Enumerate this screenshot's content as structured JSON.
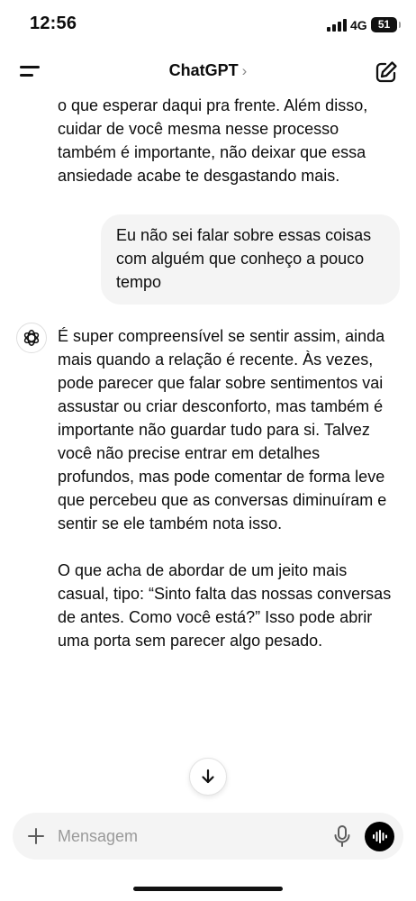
{
  "status_bar": {
    "time": "12:56",
    "network": "4G",
    "battery": "51"
  },
  "header": {
    "title": "ChatGPT",
    "chevron": "›",
    "menu_icon": "hamburger-menu-icon",
    "compose_icon": "new-chat-edit-icon"
  },
  "conversation": {
    "previous_assistant_tail": "o que esperar daqui pra frente. Além disso, cuidar de você mesma nesse processo também é importante, não deixar que essa ansiedade acabe te desgastando mais.",
    "user_message": "Eu não sei falar sobre essas coisas com alguém que conheço a pouco tempo",
    "assistant_paragraphs": [
      "É super compreensível se sentir assim, ainda mais quando a relação é recente. Às vezes, pode parecer que falar sobre sentimentos vai assustar ou criar desconforto, mas também é importante não guardar tudo para si. Talvez você não precise entrar em detalhes profundos, mas pode comentar de forma leve que percebeu que as conversas diminuíram e sentir se ele também nota isso.",
      "O que acha de abordar de um jeito mais casual, tipo: “Sinto falta das nossas conversas de antes. Como você está?” Isso pode abrir uma porta sem parecer algo pesado."
    ]
  },
  "composer": {
    "placeholder": "Mensagem",
    "plus_icon": "plus-icon",
    "mic_icon": "microphone-icon",
    "voice_icon": "voice-mode-waveform-icon"
  },
  "scroll_button_icon": "arrow-down-icon",
  "colors": {
    "background": "#ffffff",
    "user_bubble": "#f4f4f4",
    "composer": "#f4f4f4",
    "text": "#0d0d0d",
    "placeholder": "#9a9a9a",
    "voice_button": "#000000"
  }
}
